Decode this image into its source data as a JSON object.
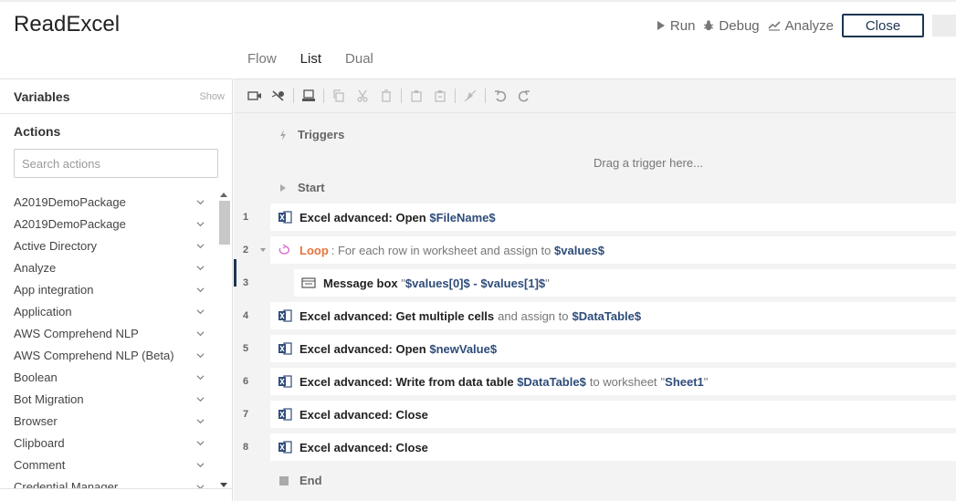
{
  "app": {
    "title": "ReadExcel",
    "run_label": "Run",
    "debug_label": "Debug",
    "analyze_label": "Analyze",
    "close_label": "Close"
  },
  "tabs": [
    {
      "label": "Flow"
    },
    {
      "label": "List"
    },
    {
      "label": "Dual"
    }
  ],
  "sidebar": {
    "variables_label": "Variables",
    "show_label": "Show",
    "actions_label": "Actions",
    "search_placeholder": "Search actions",
    "items": [
      {
        "label": "A2019DemoPackage"
      },
      {
        "label": "A2019DemoPackage"
      },
      {
        "label": "Active Directory"
      },
      {
        "label": "Analyze"
      },
      {
        "label": "App integration"
      },
      {
        "label": "Application"
      },
      {
        "label": "AWS Comprehend NLP"
      },
      {
        "label": "AWS Comprehend NLP (Beta)"
      },
      {
        "label": "Boolean"
      },
      {
        "label": "Bot Migration"
      },
      {
        "label": "Browser"
      },
      {
        "label": "Clipboard"
      },
      {
        "label": "Comment"
      },
      {
        "label": "Credential Manager"
      }
    ]
  },
  "flow": {
    "triggers_label": "Triggers",
    "drag_hint": "Drag a trigger here...",
    "start_label": "Start",
    "end_label": "End",
    "steps": [
      {
        "num": "1",
        "action": "Excel advanced: Open",
        "var": "$FileName$"
      },
      {
        "num": "2",
        "loop": "Loop",
        "desc": ": For each row in worksheet and assign to",
        "var": "$values$"
      },
      {
        "num": "3",
        "action": "Message box",
        "quote_open": "\"",
        "var_a": "$values[0]$",
        "dash": "-",
        "var_b": "$values[1]$",
        "quote_close": "\""
      },
      {
        "num": "4",
        "action": "Excel advanced: Get multiple cells",
        "desc": "and assign to",
        "var": "$DataTable$"
      },
      {
        "num": "5",
        "action": "Excel advanced: Open",
        "var": "$newValue$"
      },
      {
        "num": "6",
        "action": "Excel advanced: Write from data table",
        "var": "$DataTable$",
        "desc": "to worksheet",
        "quote_open": "\"",
        "sheet": "Sheet1",
        "quote_close": "\""
      },
      {
        "num": "7",
        "action": "Excel advanced: Close"
      },
      {
        "num": "8",
        "action": "Excel advanced: Close"
      }
    ]
  },
  "colors": {
    "accent": "#1c3552",
    "variable": "#2e4c7a",
    "loop": "#e8743b",
    "excel_icon": "#2e4c7a"
  }
}
